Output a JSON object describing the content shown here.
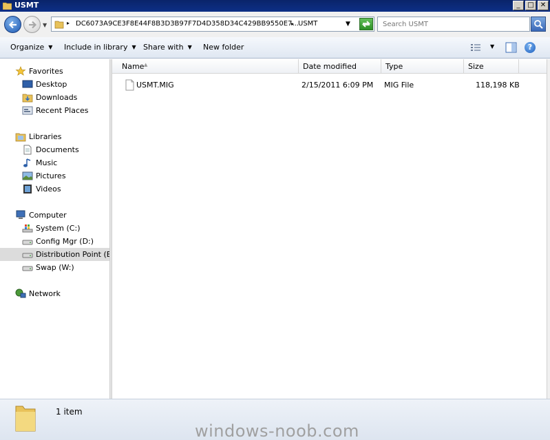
{
  "window": {
    "title": "USMT"
  },
  "address": {
    "path_segment": "DC6073A9CE3F8E44F8B3D3B97F7D4D358D34C429BB9550E7...",
    "current_folder": "USMT"
  },
  "search": {
    "placeholder": "Search USMT"
  },
  "toolbar": {
    "organize": "Organize",
    "include_in_library": "Include in library",
    "share_with": "Share with",
    "new_folder": "New folder"
  },
  "nav": {
    "favorites": "Favorites",
    "desktop": "Desktop",
    "downloads": "Downloads",
    "recent_places": "Recent Places",
    "libraries": "Libraries",
    "documents": "Documents",
    "music": "Music",
    "pictures": "Pictures",
    "videos": "Videos",
    "computer": "Computer",
    "system_c": "System (C:)",
    "config_mgr_d": "Config Mgr (D:)",
    "distribution_point_e": "Distribution Point (E:)",
    "swap_w": "Swap (W:)",
    "network": "Network"
  },
  "columns": {
    "name": "Name",
    "date_modified": "Date modified",
    "type": "Type",
    "size": "Size"
  },
  "files": [
    {
      "name": "USMT.MIG",
      "date_modified": "2/15/2011 6:09 PM",
      "type": "MIG File",
      "size": "118,198 KB"
    }
  ],
  "details": {
    "count": "1 item"
  },
  "watermark": "windows-noob.com"
}
